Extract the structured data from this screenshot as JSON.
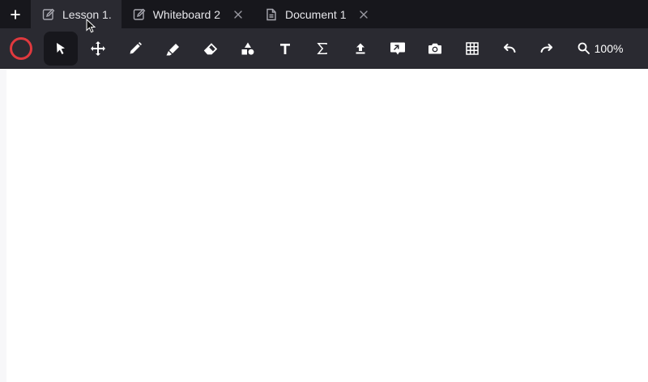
{
  "tabs": [
    {
      "label": "Lesson 1.",
      "icon": "edit-icon",
      "active": true
    },
    {
      "label": "Whiteboard 2",
      "icon": "edit-icon",
      "active": false
    },
    {
      "label": "Document 1",
      "icon": "document-icon",
      "active": false
    }
  ],
  "toolbar": {
    "color": "#e0393e",
    "tools": [
      "select-pointer-icon",
      "move-icon",
      "pen-icon",
      "highlighter-icon",
      "eraser-icon",
      "shapes-icon",
      "text-icon",
      "sigma-icon",
      "upload-icon",
      "screen-share-icon",
      "camera-icon",
      "grid-icon",
      "undo-icon",
      "redo-icon"
    ],
    "selected_tool": "select-pointer-icon",
    "zoom_label": "100%"
  }
}
